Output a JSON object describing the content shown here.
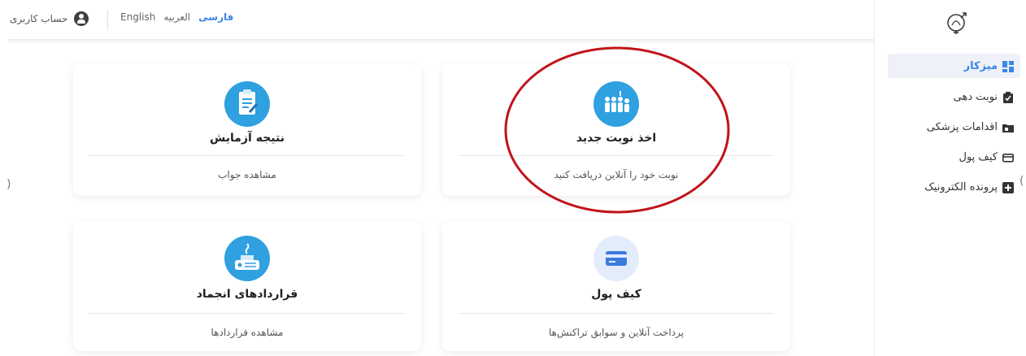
{
  "topbar": {
    "account_label": "حساب کاربری",
    "languages": [
      "English",
      "العربیه",
      "فارسی"
    ],
    "active_language": "فارسی"
  },
  "sidebar": {
    "items": [
      {
        "label": "میزکار",
        "icon": "dashboard-icon",
        "active": true
      },
      {
        "label": "نوبت دهی",
        "icon": "clipboard-check-icon",
        "active": false
      },
      {
        "label": "اقدامات پزشکی",
        "icon": "medical-folder-icon",
        "active": false
      },
      {
        "label": "کیف پول",
        "icon": "credit-card-icon",
        "active": false
      },
      {
        "label": "پرونده الکترونیک",
        "icon": "plus-box-icon",
        "active": false
      }
    ]
  },
  "cards": {
    "test_result": {
      "title": "نتیجه آزمایش",
      "subtitle": "مشاهده جواب",
      "icon": "lab-report-icon"
    },
    "new_appointment": {
      "title": "اخذ نوبت جدید",
      "subtitle": "نوبت خود را آنلاین دریافت کنید",
      "icon": "queue-people-icon"
    },
    "freeze_contracts": {
      "title": "قراردادهای انجماد",
      "subtitle": "مشاهده قراردادها",
      "icon": "freeze-device-icon"
    },
    "wallet": {
      "title": "کیف پول",
      "subtitle": "پرداخت آنلاین و سوابق تراکنش‌ها",
      "icon": "wallet-card-icon"
    }
  },
  "colors": {
    "accent": "#3a86e8",
    "icon_blue": "#2fa0e0",
    "annotation_red": "#c0141a"
  }
}
